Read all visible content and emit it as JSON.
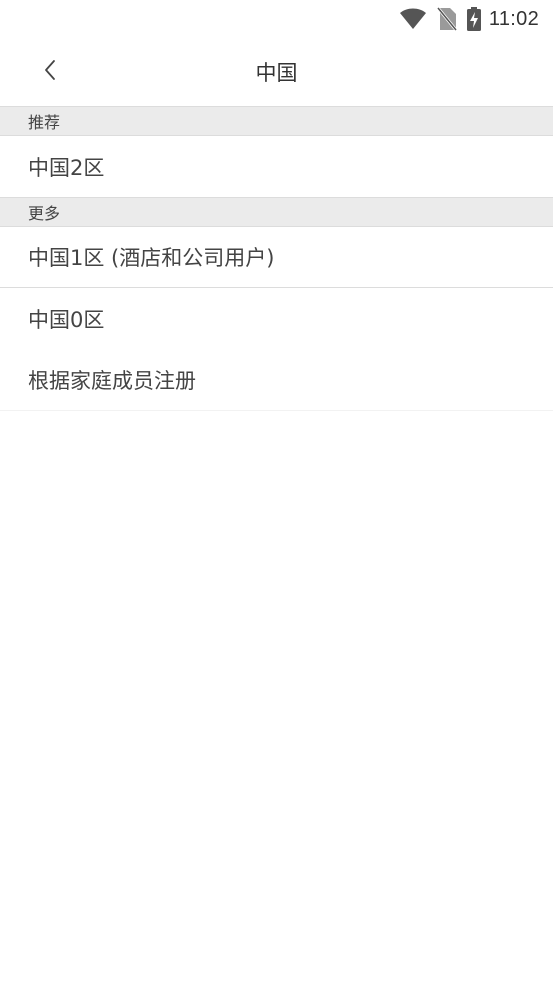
{
  "status_bar": {
    "time": "11:02",
    "icons": [
      "wifi-icon",
      "no-sim-icon",
      "battery-charging-icon"
    ]
  },
  "app_bar": {
    "title": "中国",
    "back_icon": "chevron-left-icon"
  },
  "sections": {
    "recommended": {
      "header": "推荐",
      "items": [
        "中国2区"
      ]
    },
    "more": {
      "header": "更多",
      "items": [
        "中国1区 (酒店和公司用户)",
        "中国0区",
        "根据家庭成员注册"
      ]
    }
  },
  "colors": {
    "section_bg": "#ebebeb",
    "divider": "#dcdcdc",
    "text": "#444444"
  }
}
